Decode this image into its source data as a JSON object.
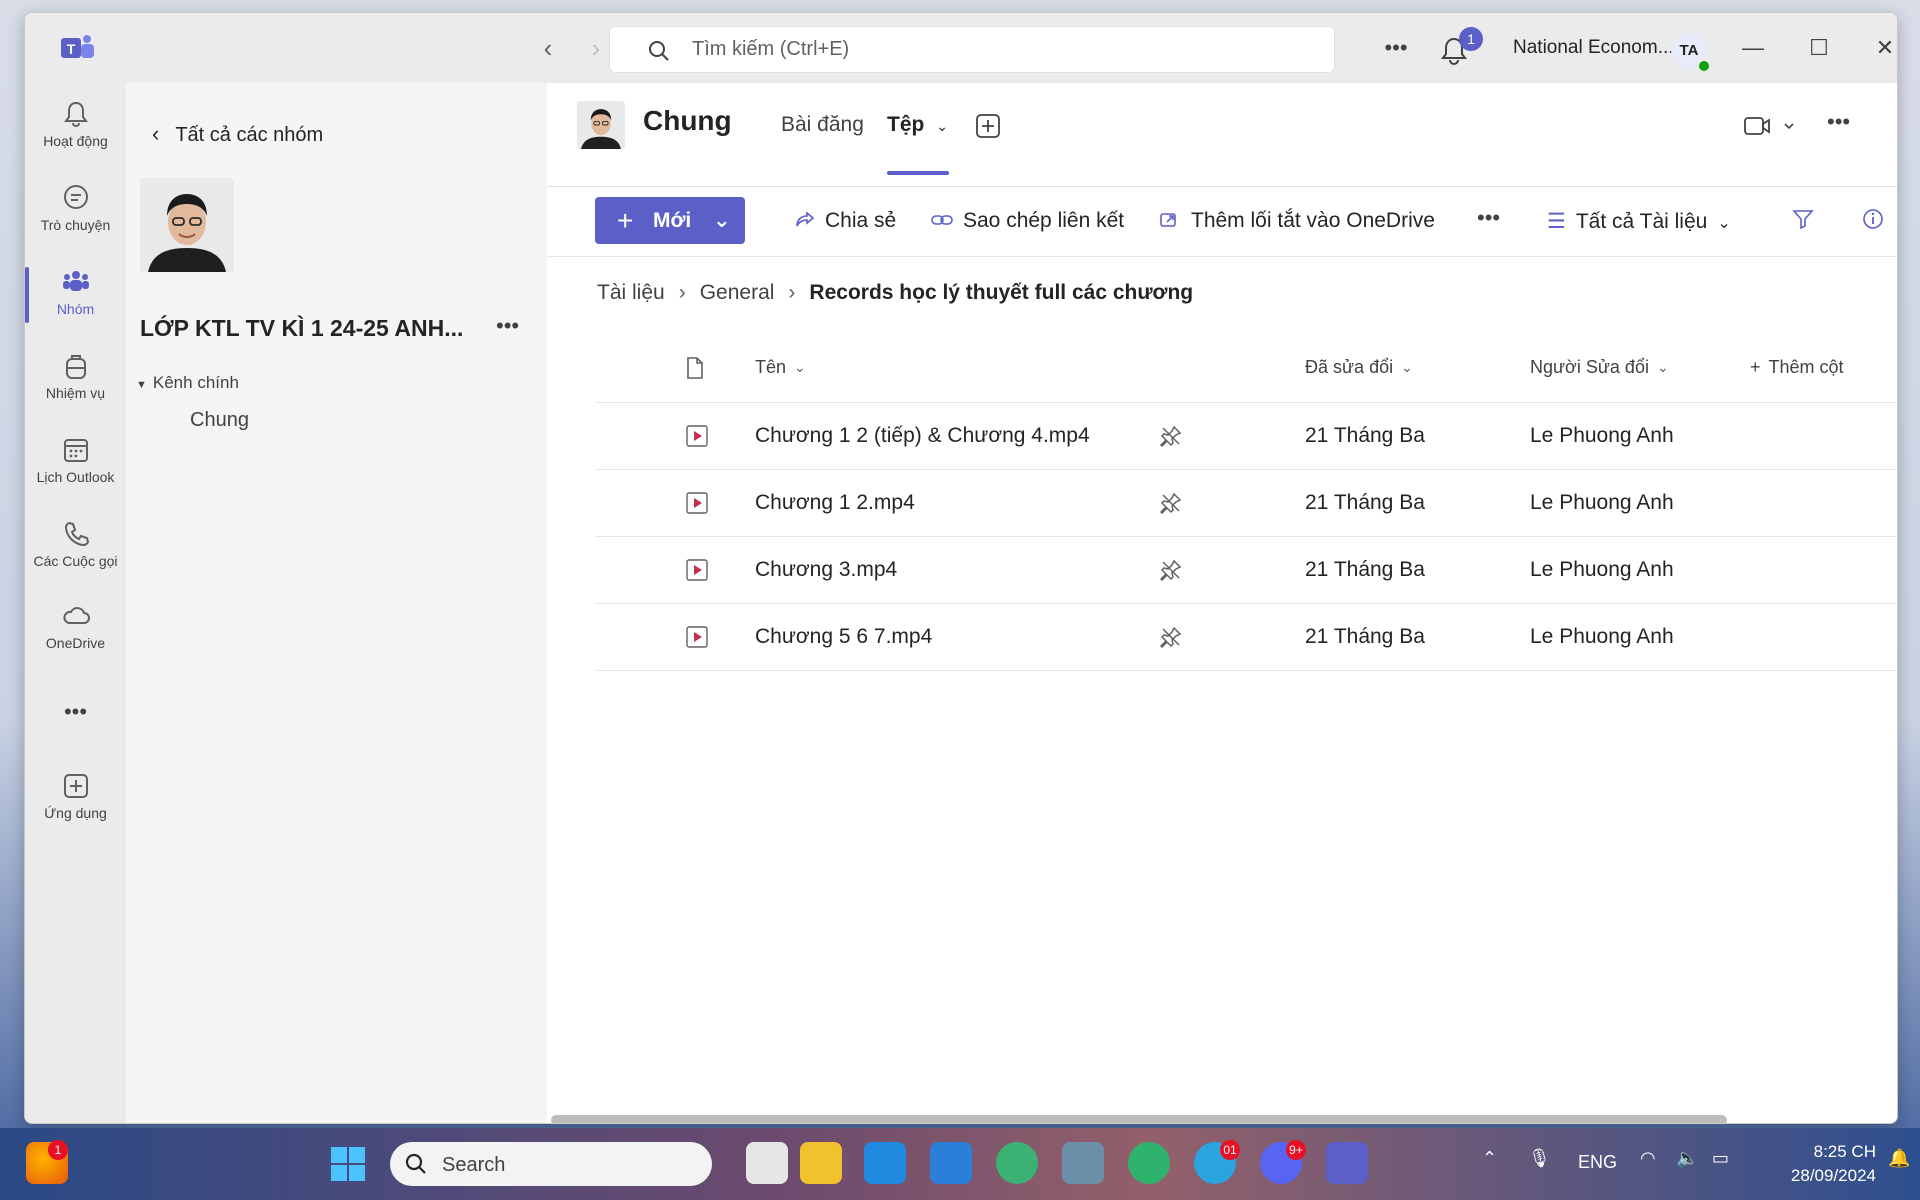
{
  "titlebar": {
    "search_placeholder": "Tìm kiếm (Ctrl+E)",
    "notifications_count": "1",
    "org_name": "National Econom...",
    "avatar_initials": "TA"
  },
  "rail": {
    "items": [
      {
        "label": "Hoạt động",
        "icon": "bell-icon"
      },
      {
        "label": "Trò chuyện",
        "icon": "chat-icon"
      },
      {
        "label": "Nhóm",
        "icon": "teams-icon"
      },
      {
        "label": "Nhiệm vụ",
        "icon": "backpack-icon"
      },
      {
        "label": "Lịch Outlook",
        "icon": "calendar-icon"
      },
      {
        "label": "Các Cuộc gọi",
        "icon": "phone-icon"
      },
      {
        "label": "OneDrive",
        "icon": "cloud-icon"
      },
      {
        "label": "Ứng dụng",
        "icon": "add-app-icon"
      }
    ]
  },
  "teampane": {
    "back_label": "Tất cả các nhóm",
    "team_name": "LỚP KTL TV KÌ 1 24-25 ANH...",
    "channels_header": "Kênh chính",
    "channels": [
      "Chung"
    ]
  },
  "channel": {
    "name": "Chung",
    "tabs": [
      {
        "label": "Bài đăng",
        "active": false
      },
      {
        "label": "Tệp",
        "active": true
      }
    ]
  },
  "toolbar": {
    "new_label": "Mới",
    "share_label": "Chia sẻ",
    "copy_link_label": "Sao chép liên kết",
    "add_shortcut_label": "Thêm lối tắt vào OneDrive",
    "view_label": "Tất cả Tài liệu"
  },
  "breadcrumb": {
    "items": [
      "Tài liệu",
      "General"
    ],
    "current": "Records học lý thuyết full các chương"
  },
  "files": {
    "columns": {
      "name": "Tên",
      "modified": "Đã sửa đổi",
      "modified_by": "Người Sửa đổi",
      "add_column": "Thêm cột"
    },
    "rows": [
      {
        "name": "Chương 1 2 (tiếp) & Chương 4.mp4",
        "modified": "21 Tháng Ba",
        "modified_by": "Le Phuong Anh"
      },
      {
        "name": "Chương 1 2.mp4",
        "modified": "21 Tháng Ba",
        "modified_by": "Le Phuong Anh"
      },
      {
        "name": "Chương 3.mp4",
        "modified": "21 Tháng Ba",
        "modified_by": "Le Phuong Anh"
      },
      {
        "name": "Chương 5 6 7.mp4",
        "modified": "21 Tháng Ba",
        "modified_by": "Le Phuong Anh"
      }
    ]
  },
  "taskbar": {
    "search_label": "Search",
    "language": "ENG",
    "time": "8:25 CH",
    "date": "28/09/2024",
    "badges": {
      "firefox": "1",
      "telegram": "01",
      "discord": "9+"
    }
  },
  "colors": {
    "accent": "#5b5fc7",
    "rail_bg": "#ebebeb",
    "pane_bg": "#f5f5f5"
  }
}
